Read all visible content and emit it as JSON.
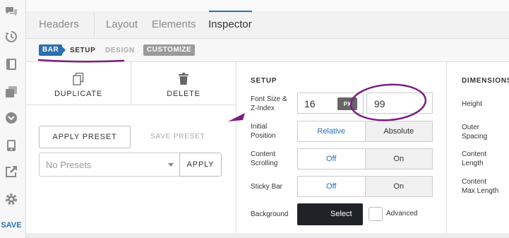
{
  "sidebar": {
    "icons": [
      "chat-icon",
      "history-icon",
      "layout-icon",
      "copy-icon",
      "chevron-circle-icon",
      "device-icon",
      "export-icon",
      "gear-icon"
    ],
    "save_label": "SAVE"
  },
  "tabs": {
    "headers": "Headers",
    "layout": "Layout",
    "elements": "Elements",
    "inspector": "Inspector"
  },
  "subtabs": {
    "bar": "BAR",
    "setup": "SETUP",
    "design": "DESIGN",
    "customize": "CUSTOMIZE"
  },
  "left": {
    "duplicate_label": "DUPLICATE",
    "delete_label": "DELETE",
    "apply_preset_label": "APPLY PRESET",
    "save_preset_label": "SAVE PRESET",
    "presets_value": "No Presets",
    "apply_label": "APPLY"
  },
  "setup": {
    "title": "SETUP",
    "font_size_label_1": "Font Size &",
    "font_size_label_2": "Z-Index",
    "font_size_value": "16",
    "font_unit": "PX",
    "z_index_value": "99",
    "initial_position_label_1": "Initial",
    "initial_position_label_2": "Position",
    "relative_label": "Relative",
    "absolute_label": "Absolute",
    "content_scrolling_label_1": "Content",
    "content_scrolling_label_2": "Scrolling",
    "scroll_off": "Off",
    "scroll_on": "On",
    "sticky_bar_label": "Sticky Bar",
    "sticky_off": "Off",
    "sticky_on": "On",
    "background_label": "Background",
    "select_label": "Select",
    "advanced_label": "Advanced"
  },
  "dimensions": {
    "title": "DIMENSIONS",
    "height_label": "Height",
    "outer_spacing_label_1": "Outer",
    "outer_spacing_label_2": "Spacing",
    "content_length_label_1": "Content",
    "content_length_label_2": "Length",
    "content_max_length_label_1": "Content",
    "content_max_length_label_2": "Max Length"
  },
  "colors": {
    "accent": "#2a6fb0",
    "annotation": "#7b1d7e"
  }
}
